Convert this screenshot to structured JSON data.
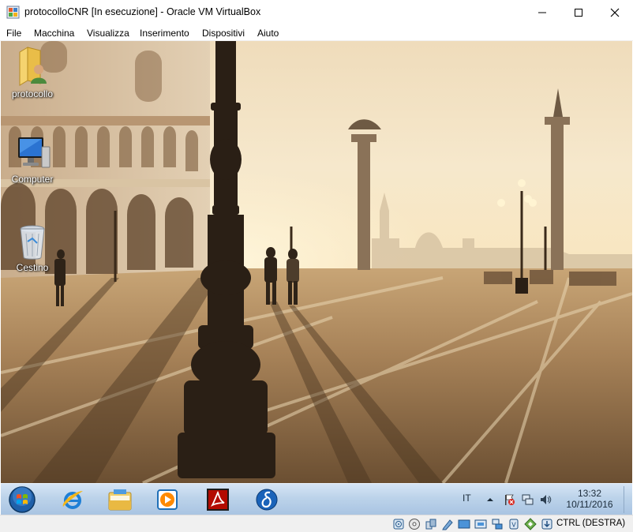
{
  "window": {
    "title": "protocolloCNR [In esecuzione] - Oracle VM VirtualBox",
    "minimize_icon": "minimize-icon",
    "maximize_icon": "maximize-icon",
    "close_icon": "close-icon"
  },
  "menubar": {
    "items": [
      "File",
      "Macchina",
      "Visualizza",
      "Inserimento",
      "Dispositivi",
      "Aiuto"
    ]
  },
  "desktop": {
    "wallpaper": "Venice Piazza San Marco at sunrise",
    "icons": [
      {
        "label": "protocollo",
        "icon": "user-folder-icon"
      },
      {
        "label": "Computer",
        "icon": "computer-icon"
      },
      {
        "label": "Cestino",
        "icon": "recycle-bin-icon"
      }
    ]
  },
  "taskbar": {
    "start_icon": "windows-start-orb-icon",
    "pinned": [
      "internet-explorer-icon",
      "file-explorer-icon",
      "media-player-icon",
      "pdf-reader-icon",
      "delta-app-icon"
    ],
    "language": "IT",
    "tray_icons": [
      "show-hidden-icons-arrow-icon",
      "action-center-flag-icon",
      "network-icon",
      "volume-icon"
    ],
    "time": "13:32",
    "date": "10/11/2016"
  },
  "statusbar": {
    "icons": [
      "hard-disk-icon",
      "optical-drive-icon",
      "usb-icon",
      "shared-folders-icon",
      "display-icon",
      "screen-capture-icon",
      "network-adapter-icon",
      "cpu-icon",
      "mouse-integration-icon",
      "keyboard-capture-icon"
    ],
    "host_key": "CTRL (DESTRA)"
  },
  "colors": {
    "taskbar": "#b5cde8",
    "statusbar": "#f0f0f0",
    "sky": "#f4e3c4"
  }
}
